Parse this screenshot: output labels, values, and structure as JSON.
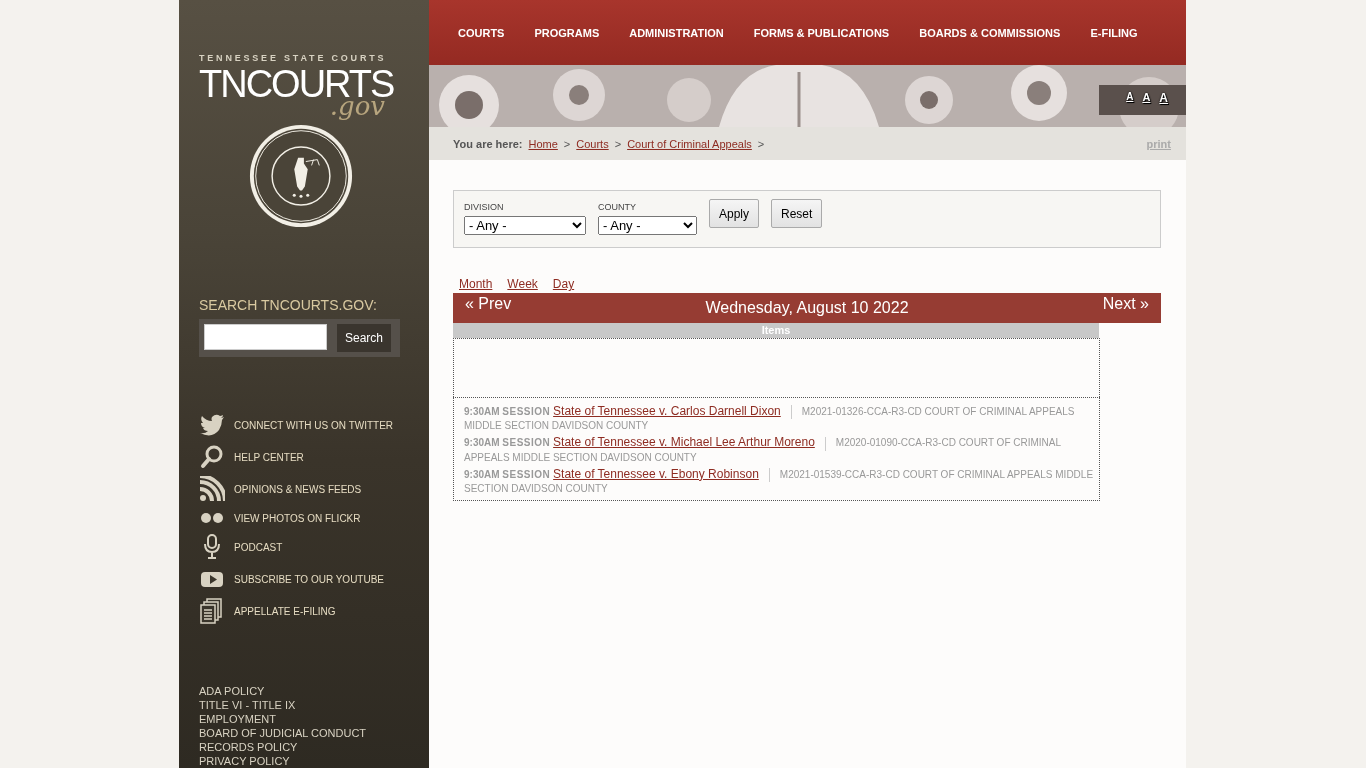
{
  "logo": {
    "tagline": "TENNESSEE STATE COURTS",
    "name": "TNCOURTS",
    "suffix": ".gov"
  },
  "search": {
    "label": "SEARCH TNCOURTS.GOV:",
    "button": "Search"
  },
  "social": [
    {
      "kind": "twitter",
      "label": "CONNECT WITH US ON TWITTER"
    },
    {
      "kind": "help",
      "label": "HELP CENTER"
    },
    {
      "kind": "rss",
      "label": "OPINIONS & NEWS FEEDS"
    },
    {
      "kind": "flickr",
      "label": "VIEW PHOTOS ON FLICKR"
    },
    {
      "kind": "podcast",
      "label": "PODCAST"
    },
    {
      "kind": "youtube",
      "label": "SUBSCRIBE TO OUR YOUTUBE"
    },
    {
      "kind": "efiling",
      "label": "APPELLATE E-FILING"
    }
  ],
  "footer_links": [
    "ADA POLICY",
    "TITLE VI - TITLE IX",
    "EMPLOYMENT",
    "BOARD OF JUDICIAL CONDUCT",
    "RECORDS POLICY",
    "PRIVACY POLICY"
  ],
  "nav": [
    "COURTS",
    "PROGRAMS",
    "ADMINISTRATION",
    "FORMS & PUBLICATIONS",
    "BOARDS & COMMISSIONS",
    "E-FILING"
  ],
  "text_size": [
    "A",
    "A",
    "A"
  ],
  "breadcrumb": {
    "label": "You are here:",
    "items": [
      "Home",
      "Courts",
      "Court of Criminal Appeals"
    ],
    "separator": ">",
    "print": "print"
  },
  "filters": [
    {
      "label": "DIVISION",
      "value": "- Any -"
    },
    {
      "label": "COUNTY",
      "value": "- Any -"
    }
  ],
  "filter_buttons": [
    "Apply",
    "Reset"
  ],
  "views": [
    "Month",
    "Week",
    "Day"
  ],
  "calendar": {
    "prev": "« Prev",
    "title": "Wednesday, August 10 2022",
    "next": "Next »",
    "column": "Items",
    "events": [
      {
        "time": "9:30AM",
        "type": "SESSION",
        "title": "State of Tennessee v. Carlos Darnell Dixon",
        "details": "M2021-01326-CCA-R3-CD COURT OF CRIMINAL APPEALS MIDDLE SECTION DAVIDSON COUNTY"
      },
      {
        "time": "9:30AM",
        "type": "SESSION",
        "title": "State of Tennessee v. Michael Lee Arthur Moreno",
        "details": "M2020-01090-CCA-R3-CD COURT OF CRIMINAL APPEALS MIDDLE SECTION DAVIDSON COUNTY"
      },
      {
        "time": "9:30AM",
        "type": "SESSION",
        "title": "State of Tennessee v. Ebony Robinson",
        "details": "M2021-01539-CCA-R3-CD COURT OF CRIMINAL APPEALS MIDDLE SECTION DAVIDSON COUNTY"
      }
    ]
  }
}
